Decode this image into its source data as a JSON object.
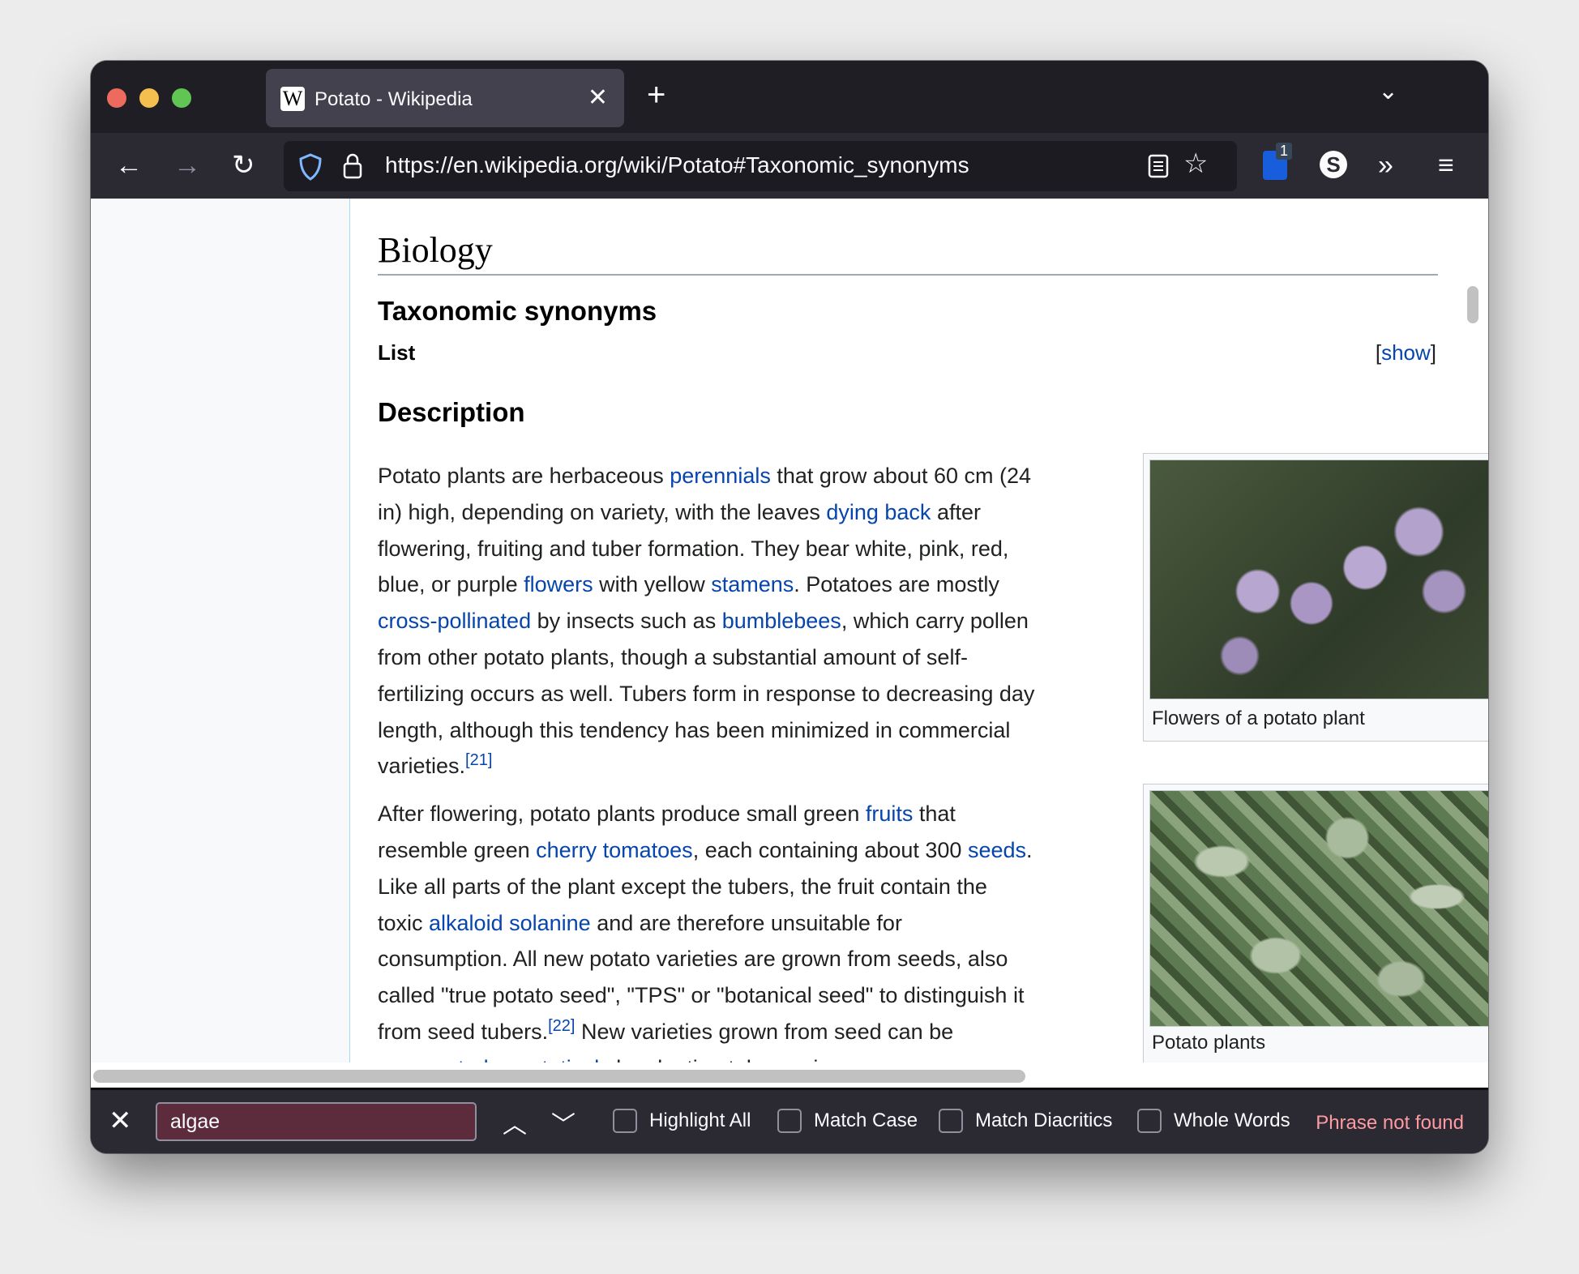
{
  "window": {
    "traffic_lights": [
      "#ed6a5e",
      "#f5bf4f",
      "#61c554"
    ]
  },
  "tab": {
    "title": "Potato - Wikipedia",
    "favicon": "W"
  },
  "toolbar": {
    "url": "https://en.wikipedia.org/wiki/Potato#Taxonomic_synonyms",
    "badge_count": "1"
  },
  "article": {
    "section_title": "Biology",
    "subsection_taxonomic": "Taxonomic synonyms",
    "list_label": "List",
    "show_open": "[",
    "show_label": "show",
    "show_close": "]",
    "subsection_description": "Description",
    "paragraphs": [
      [
        {
          "t": "Potato plants are herbaceous "
        },
        {
          "t": "perennials",
          "link": true
        },
        {
          "t": " that grow about 60 cm (24 in) high, depending on variety, with the leaves "
        },
        {
          "t": "dying back",
          "link": true
        },
        {
          "t": " after flowering, fruiting and tuber formation. They bear white, pink, red, blue, or purple "
        },
        {
          "t": "flowers",
          "link": true
        },
        {
          "t": " with yellow "
        },
        {
          "t": "stamens",
          "link": true
        },
        {
          "t": ". Potatoes are mostly "
        },
        {
          "t": "cross-pollinated",
          "link": true
        },
        {
          "t": " by insects such as "
        },
        {
          "t": "bumblebees",
          "link": true
        },
        {
          "t": ", which carry pollen from other potato plants, though a substantial amount of self-fertilizing occurs as well. Tubers form in response to decreasing day length, although this tendency has been minimized in commercial varieties."
        },
        {
          "t": "[21]",
          "sup": true
        }
      ],
      [
        {
          "t": "After flowering, potato plants produce small green "
        },
        {
          "t": "fruits",
          "link": true
        },
        {
          "t": " that resemble green "
        },
        {
          "t": "cherry tomatoes",
          "link": true
        },
        {
          "t": ", each containing about 300 "
        },
        {
          "t": "seeds",
          "link": true
        },
        {
          "t": ". Like all parts of the plant except the tubers, the fruit contain the toxic "
        },
        {
          "t": "alkaloid",
          "link": true
        },
        {
          "t": " "
        },
        {
          "t": "solanine",
          "link": true
        },
        {
          "t": " and are therefore unsuitable for consumption. All new potato varieties are grown from seeds, also called \"true potato seed\", \"TPS\" or \"botanical seed\" to distinguish it from seed tubers."
        },
        {
          "t": "[22]",
          "sup": true
        },
        {
          "t": " New varieties grown from seed can be "
        },
        {
          "t": "propagated vegetatively",
          "link": true
        },
        {
          "t": " by planting tubers, pieces"
        }
      ]
    ],
    "images": [
      {
        "caption": "Flowers of a potato plant"
      },
      {
        "caption": "Potato plants"
      }
    ]
  },
  "findbar": {
    "query": "algae",
    "options": [
      "Highlight All",
      "Match Case",
      "Match Diacritics",
      "Whole Words"
    ],
    "status": "Phrase not found",
    "status_color": "#ff9aa2"
  }
}
